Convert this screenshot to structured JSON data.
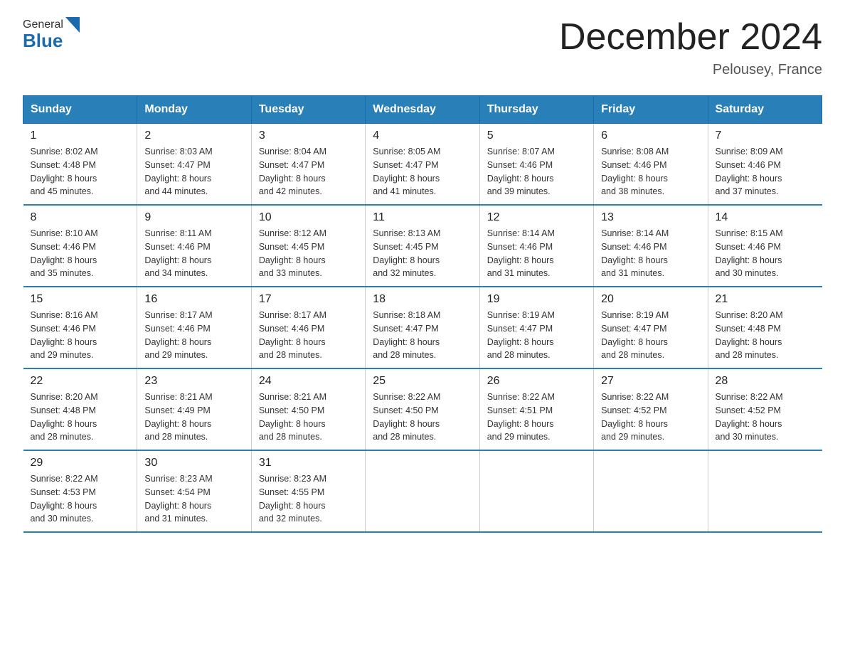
{
  "header": {
    "title": "December 2024",
    "subtitle": "Pelousey, France",
    "logo_line1": "General",
    "logo_line2": "Blue"
  },
  "days_of_week": [
    "Sunday",
    "Monday",
    "Tuesday",
    "Wednesday",
    "Thursday",
    "Friday",
    "Saturday"
  ],
  "weeks": [
    [
      {
        "day": "1",
        "sunrise": "8:02 AM",
        "sunset": "4:48 PM",
        "daylight": "8 hours and 45 minutes."
      },
      {
        "day": "2",
        "sunrise": "8:03 AM",
        "sunset": "4:47 PM",
        "daylight": "8 hours and 44 minutes."
      },
      {
        "day": "3",
        "sunrise": "8:04 AM",
        "sunset": "4:47 PM",
        "daylight": "8 hours and 42 minutes."
      },
      {
        "day": "4",
        "sunrise": "8:05 AM",
        "sunset": "4:47 PM",
        "daylight": "8 hours and 41 minutes."
      },
      {
        "day": "5",
        "sunrise": "8:07 AM",
        "sunset": "4:46 PM",
        "daylight": "8 hours and 39 minutes."
      },
      {
        "day": "6",
        "sunrise": "8:08 AM",
        "sunset": "4:46 PM",
        "daylight": "8 hours and 38 minutes."
      },
      {
        "day": "7",
        "sunrise": "8:09 AM",
        "sunset": "4:46 PM",
        "daylight": "8 hours and 37 minutes."
      }
    ],
    [
      {
        "day": "8",
        "sunrise": "8:10 AM",
        "sunset": "4:46 PM",
        "daylight": "8 hours and 35 minutes."
      },
      {
        "day": "9",
        "sunrise": "8:11 AM",
        "sunset": "4:46 PM",
        "daylight": "8 hours and 34 minutes."
      },
      {
        "day": "10",
        "sunrise": "8:12 AM",
        "sunset": "4:45 PM",
        "daylight": "8 hours and 33 minutes."
      },
      {
        "day": "11",
        "sunrise": "8:13 AM",
        "sunset": "4:45 PM",
        "daylight": "8 hours and 32 minutes."
      },
      {
        "day": "12",
        "sunrise": "8:14 AM",
        "sunset": "4:46 PM",
        "daylight": "8 hours and 31 minutes."
      },
      {
        "day": "13",
        "sunrise": "8:14 AM",
        "sunset": "4:46 PM",
        "daylight": "8 hours and 31 minutes."
      },
      {
        "day": "14",
        "sunrise": "8:15 AM",
        "sunset": "4:46 PM",
        "daylight": "8 hours and 30 minutes."
      }
    ],
    [
      {
        "day": "15",
        "sunrise": "8:16 AM",
        "sunset": "4:46 PM",
        "daylight": "8 hours and 29 minutes."
      },
      {
        "day": "16",
        "sunrise": "8:17 AM",
        "sunset": "4:46 PM",
        "daylight": "8 hours and 29 minutes."
      },
      {
        "day": "17",
        "sunrise": "8:17 AM",
        "sunset": "4:46 PM",
        "daylight": "8 hours and 28 minutes."
      },
      {
        "day": "18",
        "sunrise": "8:18 AM",
        "sunset": "4:47 PM",
        "daylight": "8 hours and 28 minutes."
      },
      {
        "day": "19",
        "sunrise": "8:19 AM",
        "sunset": "4:47 PM",
        "daylight": "8 hours and 28 minutes."
      },
      {
        "day": "20",
        "sunrise": "8:19 AM",
        "sunset": "4:47 PM",
        "daylight": "8 hours and 28 minutes."
      },
      {
        "day": "21",
        "sunrise": "8:20 AM",
        "sunset": "4:48 PM",
        "daylight": "8 hours and 28 minutes."
      }
    ],
    [
      {
        "day": "22",
        "sunrise": "8:20 AM",
        "sunset": "4:48 PM",
        "daylight": "8 hours and 28 minutes."
      },
      {
        "day": "23",
        "sunrise": "8:21 AM",
        "sunset": "4:49 PM",
        "daylight": "8 hours and 28 minutes."
      },
      {
        "day": "24",
        "sunrise": "8:21 AM",
        "sunset": "4:50 PM",
        "daylight": "8 hours and 28 minutes."
      },
      {
        "day": "25",
        "sunrise": "8:22 AM",
        "sunset": "4:50 PM",
        "daylight": "8 hours and 28 minutes."
      },
      {
        "day": "26",
        "sunrise": "8:22 AM",
        "sunset": "4:51 PM",
        "daylight": "8 hours and 29 minutes."
      },
      {
        "day": "27",
        "sunrise": "8:22 AM",
        "sunset": "4:52 PM",
        "daylight": "8 hours and 29 minutes."
      },
      {
        "day": "28",
        "sunrise": "8:22 AM",
        "sunset": "4:52 PM",
        "daylight": "8 hours and 30 minutes."
      }
    ],
    [
      {
        "day": "29",
        "sunrise": "8:22 AM",
        "sunset": "4:53 PM",
        "daylight": "8 hours and 30 minutes."
      },
      {
        "day": "30",
        "sunrise": "8:23 AM",
        "sunset": "4:54 PM",
        "daylight": "8 hours and 31 minutes."
      },
      {
        "day": "31",
        "sunrise": "8:23 AM",
        "sunset": "4:55 PM",
        "daylight": "8 hours and 32 minutes."
      },
      null,
      null,
      null,
      null
    ]
  ]
}
